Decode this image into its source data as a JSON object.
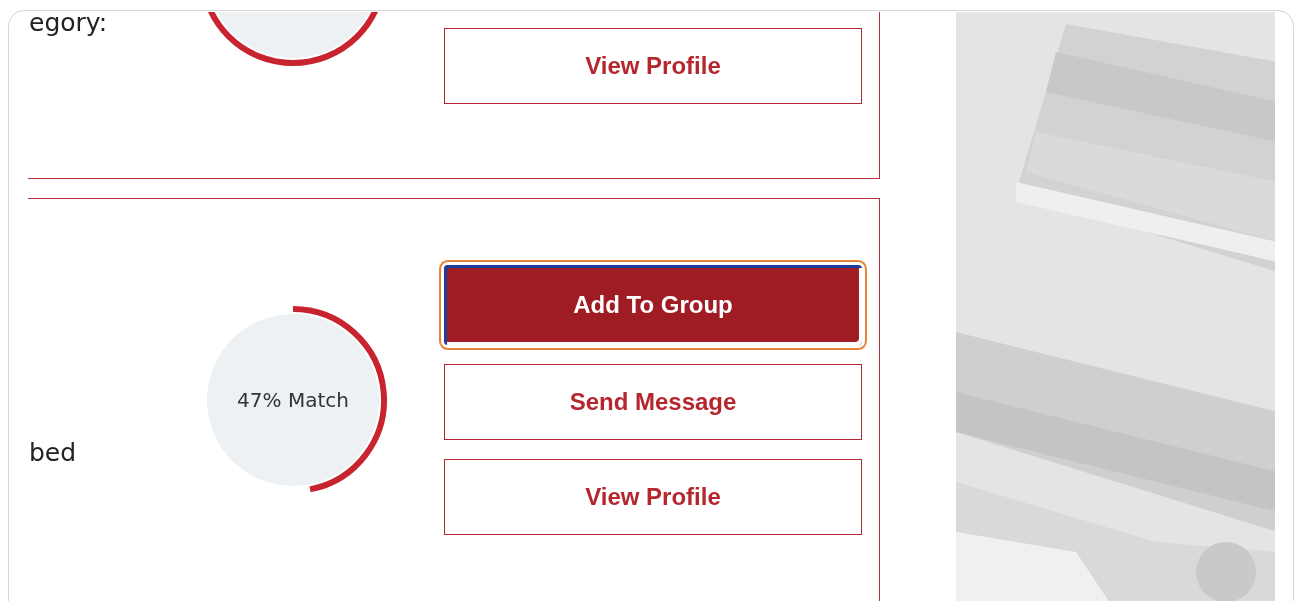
{
  "cards": [
    {
      "detail_text": "egory:",
      "buttons": [
        {
          "label": "View Profile",
          "kind": "outline",
          "focused": false
        }
      ]
    },
    {
      "detail_text": "bed",
      "match": {
        "level": 0.47,
        "text": "47% Match"
      },
      "buttons": [
        {
          "label": "Add To Group",
          "kind": "primary",
          "focused": true
        },
        {
          "label": "Send Message",
          "kind": "outline",
          "focused": false
        },
        {
          "label": "View Profile",
          "kind": "outline",
          "focused": false
        }
      ]
    }
  ]
}
